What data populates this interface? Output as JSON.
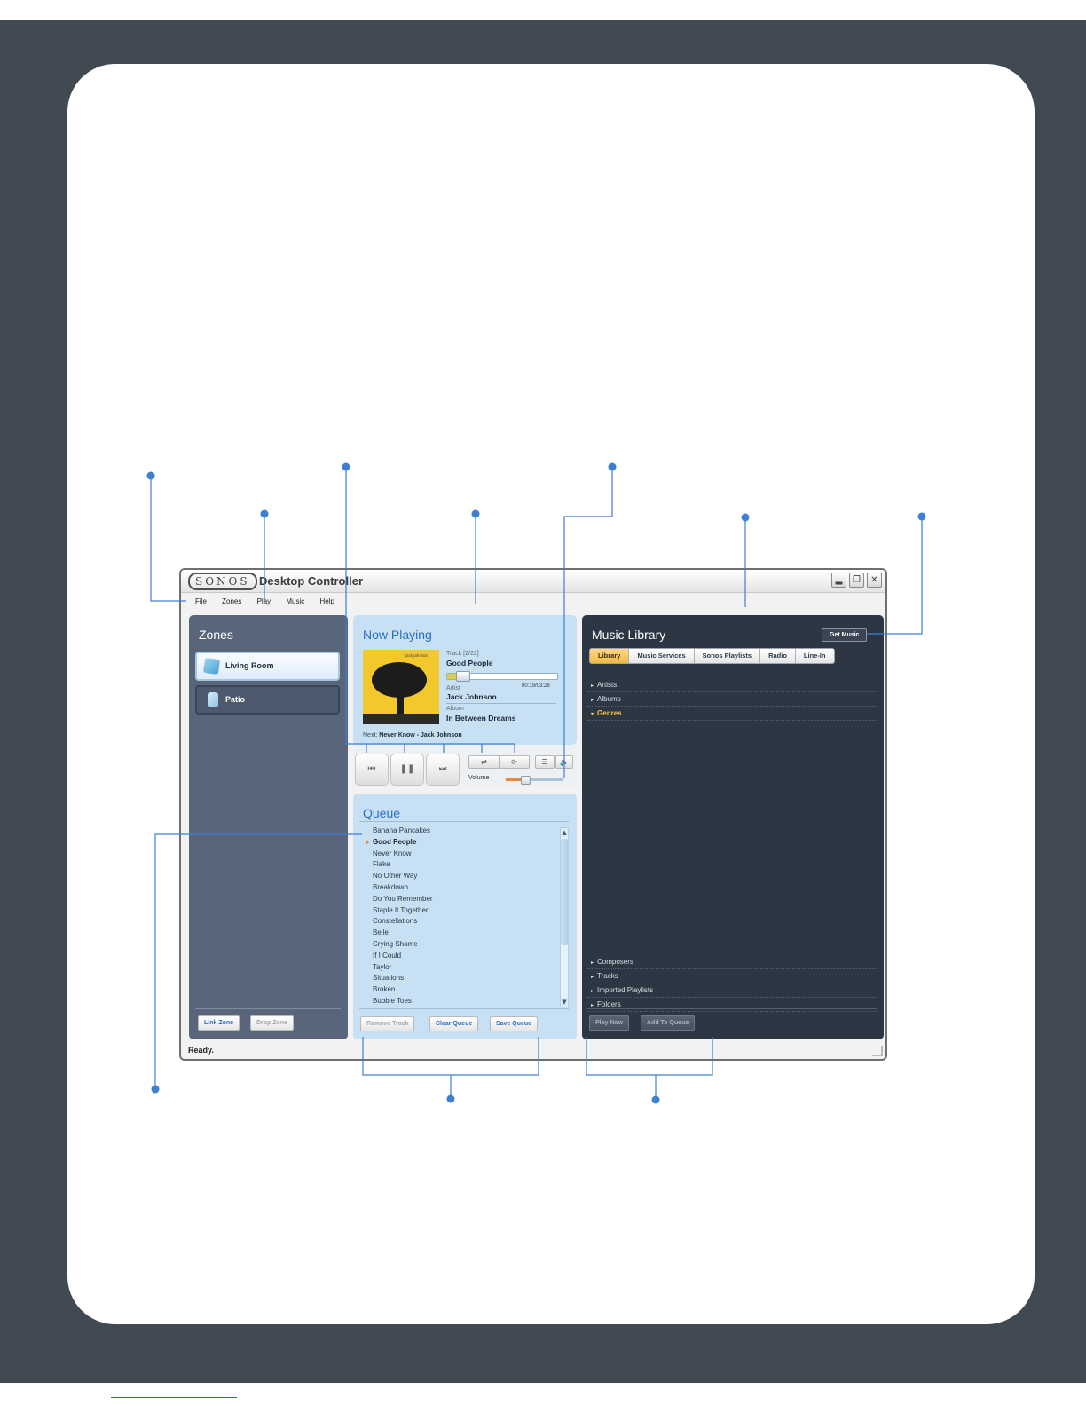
{
  "app": {
    "logo": "SONOS",
    "title": "Desktop Controller",
    "window_buttons": [
      "minimize-icon",
      "restore-icon",
      "close-icon"
    ],
    "status": "Ready."
  },
  "menu": [
    "File",
    "Zones",
    "Play",
    "Music",
    "Help"
  ],
  "zones": {
    "title": "Zones",
    "items": [
      {
        "label": "Living Room",
        "icon": "zone-player-icon",
        "selected": true
      },
      {
        "label": "Patio",
        "icon": "zone-player-icon",
        "selected": false
      }
    ],
    "link_zone": "Link Zone",
    "drop_zone": "Drop Zone"
  },
  "now_playing": {
    "title": "Now Playing",
    "album_art_text": "jack johnson",
    "track_label": "Track [2/22]",
    "track": "Good People",
    "progress": 0.14,
    "time": "00:19/03:28",
    "artist_label": "Artist",
    "artist": "Jack Johnson",
    "album_label": "Album",
    "album": "In Between Dreams",
    "next_label": "Next:",
    "next_value": "Never Know - Jack Johnson"
  },
  "transport": {
    "previous_icon": "previous-icon",
    "pause_icon": "pause-icon",
    "next_icon": "next-icon",
    "shuffle_icon": "shuffle-icon",
    "repeat_icon": "repeat-icon",
    "eq_icon": "equalizer-icon",
    "mute_icon": "mute-icon",
    "volume_label": "Volume",
    "volume": 0.32
  },
  "queue": {
    "title": "Queue",
    "tracks": [
      "Banana Pancakes",
      "Good People",
      "Never Know",
      "Flake",
      "No Other Way",
      "Breakdown",
      "Do You Remember",
      "Staple It Together",
      "Constellations",
      "Belle",
      "Crying Shame",
      "If I Could",
      "Taylor",
      "Situations",
      "Broken",
      "Bubble Toes"
    ],
    "current_index": 1,
    "remove_track": "Remove Track",
    "clear_queue": "Clear Queue",
    "save_queue": "Save Queue"
  },
  "library": {
    "title": "Music Library",
    "get_music": "Get Music",
    "tabs": [
      "Library",
      "Music Services",
      "Sonos Playlists",
      "Radio",
      "Line-In"
    ],
    "active_tab": "Library",
    "top_items": [
      {
        "label": "Artists",
        "highlighted": false
      },
      {
        "label": "Albums",
        "highlighted": false
      },
      {
        "label": "Genres",
        "highlighted": true
      }
    ],
    "bottom_items": [
      "Composers",
      "Tracks",
      "Imported Playlists",
      "Folders"
    ],
    "play_now": "Play Now",
    "add_to_queue": "Add To Queue"
  },
  "colors": {
    "page_frame": "#414a53",
    "callout": "#3d7fd1",
    "panel_light": "#c7e0f3",
    "panel_zones": "#58657a",
    "panel_library": "#2d3643",
    "accent_tab": "#f2b844"
  }
}
